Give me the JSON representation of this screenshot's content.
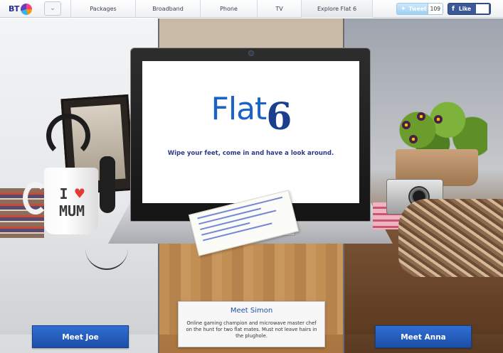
{
  "header": {
    "logo_text": "BT",
    "menu_icon": "chevron-double-down-icon",
    "tabs": [
      {
        "label": "Packages",
        "active": false
      },
      {
        "label": "Broadband",
        "active": false
      },
      {
        "label": "Phone",
        "active": false
      },
      {
        "label": "TV",
        "active": false
      },
      {
        "label": "Explore Flat 6",
        "active": true
      }
    ],
    "tweet": {
      "label": "Tweet",
      "count": "109",
      "icon": "twitter-bird-icon"
    },
    "like": {
      "label": "Like",
      "icon": "facebook-f-icon"
    }
  },
  "laptop_screen": {
    "brand_word": "Flat",
    "brand_number": "6",
    "tagline": "Wipe your feet, come in and have a look around."
  },
  "characters": {
    "joe": {
      "button_label": "Meet Joe"
    },
    "simon": {
      "title": "Meet Simon",
      "description": "Online gaming champion and microwave master chef on the hunt for two flat mates. Must not leave hairs in the plughole."
    },
    "anna": {
      "button_label": "Meet Anna"
    }
  },
  "props": {
    "mug_line1": "I",
    "mug_line2": "MUM"
  },
  "colors": {
    "brand_blue": "#1b63c6",
    "cta_blue": "#2f6fd3",
    "nav_text": "#3b3f4a"
  }
}
